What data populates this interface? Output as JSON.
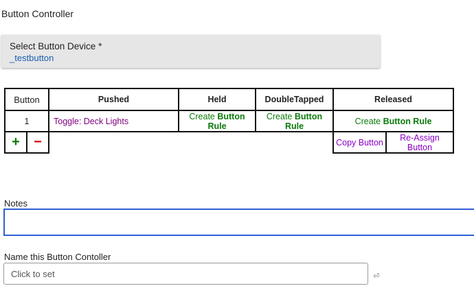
{
  "page": {
    "title": "Button Controller"
  },
  "device": {
    "label": "Select Button Device *",
    "value": "_testbutton"
  },
  "table": {
    "headers": [
      "Button",
      "Pushed",
      "Held",
      "DoubleTapped",
      "Released"
    ],
    "row": {
      "number": "1",
      "pushed": "Toggle: Deck Lights",
      "rule_prefix": "Create ",
      "rule_bold": "Button Rule"
    },
    "controls": {
      "add": "+",
      "remove": "−",
      "copy": "Copy Button",
      "reassign": "Re-Assign Button"
    }
  },
  "notes": {
    "label": "Notes",
    "value": ""
  },
  "name_field": {
    "label": "Name this Button Contoller",
    "placeholder": "Click to set"
  },
  "icons": {
    "enter": "enter-icon"
  },
  "colors": {
    "link_blue": "#1a5fb4",
    "purple": "#800080",
    "green": "#0a7a0a",
    "red": "#d40000",
    "focus_blue": "#2f5fd6"
  }
}
